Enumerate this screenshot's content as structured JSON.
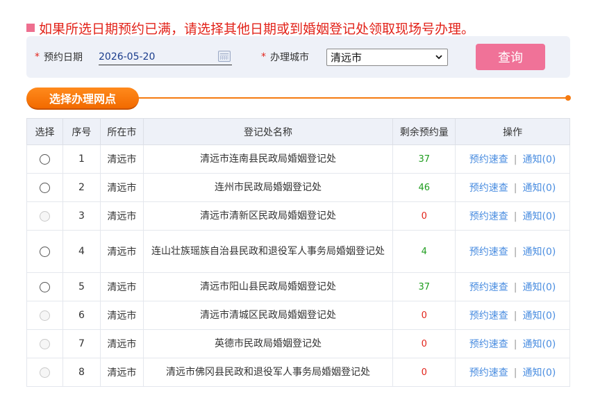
{
  "notice": "如果所选日期预约已满，请选择其他日期或到婚姻登记处领取现场号办理。",
  "search": {
    "date_label": "预约日期",
    "date_value": "2026-05-20",
    "city_label": "办理城市",
    "city_value": "清远市",
    "query_label": "查询"
  },
  "section_title": "选择办理网点",
  "table": {
    "headers": [
      "选择",
      "序号",
      "所在市",
      "登记处名称",
      "剩余预约量",
      "操作"
    ],
    "op_link1": "预约速查",
    "op_link2": "通知(0)",
    "rows": [
      {
        "no": "1",
        "city": "清远市",
        "name": "清远市连南县民政局婚姻登记处",
        "count": "37"
      },
      {
        "no": "2",
        "city": "清远市",
        "name": "连州市民政局婚姻登记处",
        "count": "46"
      },
      {
        "no": "3",
        "city": "清远市",
        "name": "清远市清新区民政局婚姻登记处",
        "count": "0"
      },
      {
        "no": "4",
        "city": "清远市",
        "name": "连山壮族瑶族自治县民政和退役军人事务局婚姻登记处",
        "count": "4"
      },
      {
        "no": "5",
        "city": "清远市",
        "name": "清远市阳山县民政局婚姻登记处",
        "count": "37"
      },
      {
        "no": "6",
        "city": "清远市",
        "name": "清远市清城区民政局婚姻登记处",
        "count": "0"
      },
      {
        "no": "7",
        "city": "清远市",
        "name": "英德市民政局婚姻登记处",
        "count": "0"
      },
      {
        "no": "8",
        "city": "清远市",
        "name": "清远市佛冈县民政和退役军人事务局婚姻登记处",
        "count": "0"
      }
    ]
  },
  "colors": {
    "notice_red": "#e2231a",
    "button_pink": "#f07298",
    "accent_orange": "#f57a10",
    "link_blue": "#4a8de0",
    "count_green": "#1f9d1f"
  }
}
